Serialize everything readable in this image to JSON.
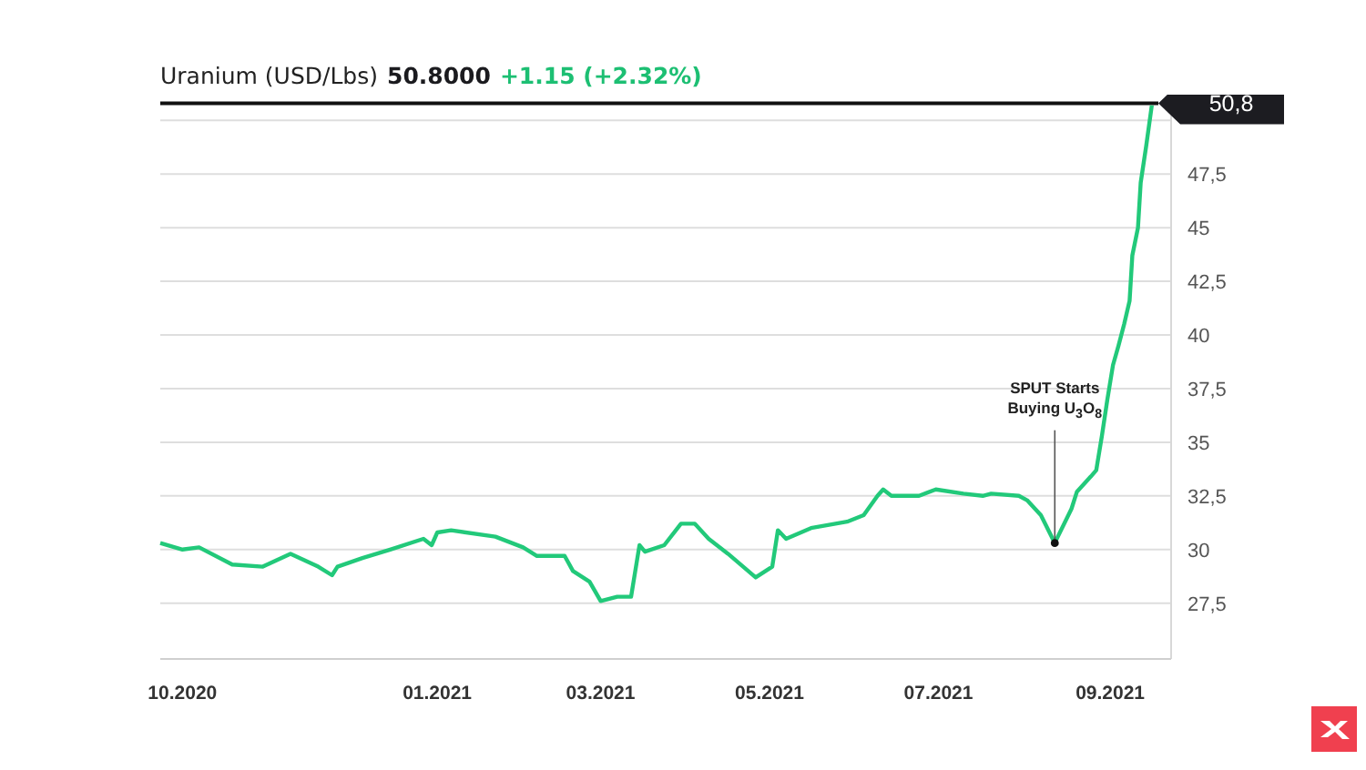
{
  "header": {
    "price": "50.8000",
    "change": "+1.15 (+2.32%)"
  },
  "chart": {
    "chart_data": {
      "type": "line",
      "x": [
        "2020-09-23",
        "2020-10-01",
        "2020-10-07",
        "2020-10-19",
        "2020-10-30",
        "2020-11-09",
        "2020-11-19",
        "2020-11-24",
        "2020-11-26",
        "2020-12-05",
        "2020-12-15",
        "2020-12-27",
        "2020-12-30",
        "2021-01-01",
        "2021-01-06",
        "2021-01-22",
        "2021-02-01",
        "2021-02-06",
        "2021-02-16",
        "2021-02-19",
        "2021-02-25",
        "2021-03-01",
        "2021-03-07",
        "2021-03-12",
        "2021-03-15",
        "2021-03-17",
        "2021-03-24",
        "2021-03-30",
        "2021-04-04",
        "2021-04-09",
        "2021-04-16",
        "2021-04-26",
        "2021-05-02",
        "2021-05-04",
        "2021-05-07",
        "2021-05-16",
        "2021-05-29",
        "2021-06-04",
        "2021-06-09",
        "2021-06-11",
        "2021-06-14",
        "2021-06-24",
        "2021-06-30",
        "2021-07-10",
        "2021-07-17",
        "2021-07-20",
        "2021-07-30",
        "2021-08-02",
        "2021-08-07",
        "2021-08-12",
        "2021-08-18",
        "2021-08-20",
        "2021-08-25",
        "2021-08-27",
        "2021-08-29",
        "2021-08-31",
        "2021-09-02",
        "2021-09-04",
        "2021-09-06",
        "2021-09-08",
        "2021-09-09",
        "2021-09-11",
        "2021-09-12",
        "2021-09-14",
        "2021-09-16"
      ],
      "series": [
        {
          "name": "Uranium (USD/Lbs)",
          "color": "#22c97a",
          "values": [
            30.3,
            30.0,
            30.1,
            29.3,
            29.2,
            29.8,
            29.2,
            28.8,
            29.2,
            29.6,
            30.0,
            30.5,
            30.2,
            30.8,
            30.9,
            30.6,
            30.1,
            29.7,
            29.7,
            29.0,
            28.5,
            27.6,
            27.8,
            27.8,
            30.2,
            29.9,
            30.2,
            31.2,
            31.2,
            30.5,
            29.8,
            28.7,
            29.2,
            30.9,
            30.5,
            31.0,
            31.3,
            31.6,
            32.5,
            32.8,
            32.5,
            32.5,
            32.8,
            32.6,
            32.5,
            32.6,
            32.5,
            32.3,
            31.6,
            30.3,
            31.9,
            32.7,
            33.4,
            33.7,
            35.3,
            37.0,
            38.6,
            39.5,
            40.5,
            41.6,
            43.7,
            45.0,
            47.1,
            48.8,
            50.7
          ]
        }
      ],
      "xlim": [
        "2020-09-23",
        "2021-09-23"
      ],
      "ylim": [
        24.9,
        51.2
      ],
      "xticks": [
        {
          "value": "2020-10-01",
          "label": "10.2020"
        },
        {
          "value": "2021-01-01",
          "label": "01.2021"
        },
        {
          "value": "2021-03-01",
          "label": "03.2021"
        },
        {
          "value": "2021-05-01",
          "label": "05.2021"
        },
        {
          "value": "2021-07-01",
          "label": "07.2021"
        },
        {
          "value": "2021-09-01",
          "label": "09.2021"
        }
      ],
      "yticks": [
        {
          "value": 27.5,
          "label": "27,5"
        },
        {
          "value": 30,
          "label": "30"
        },
        {
          "value": 32.5,
          "label": "32,5"
        },
        {
          "value": 35,
          "label": "35"
        },
        {
          "value": 37.5,
          "label": "37,5"
        },
        {
          "value": 40,
          "label": "40"
        },
        {
          "value": 42.5,
          "label": "42,5"
        },
        {
          "value": 45,
          "label": "45"
        },
        {
          "value": 47.5,
          "label": "47,5"
        }
      ],
      "annotations": [
        {
          "text": "SPUT Starts Buying U$_{3}$O$_{8}$",
          "x": "2021-08-12",
          "y": 30.3
        }
      ],
      "ref_lines": [
        {
          "axis": "y",
          "value": 50.8,
          "label": "50,8",
          "color": "#111111"
        }
      ],
      "grid": true
    }
  }
}
